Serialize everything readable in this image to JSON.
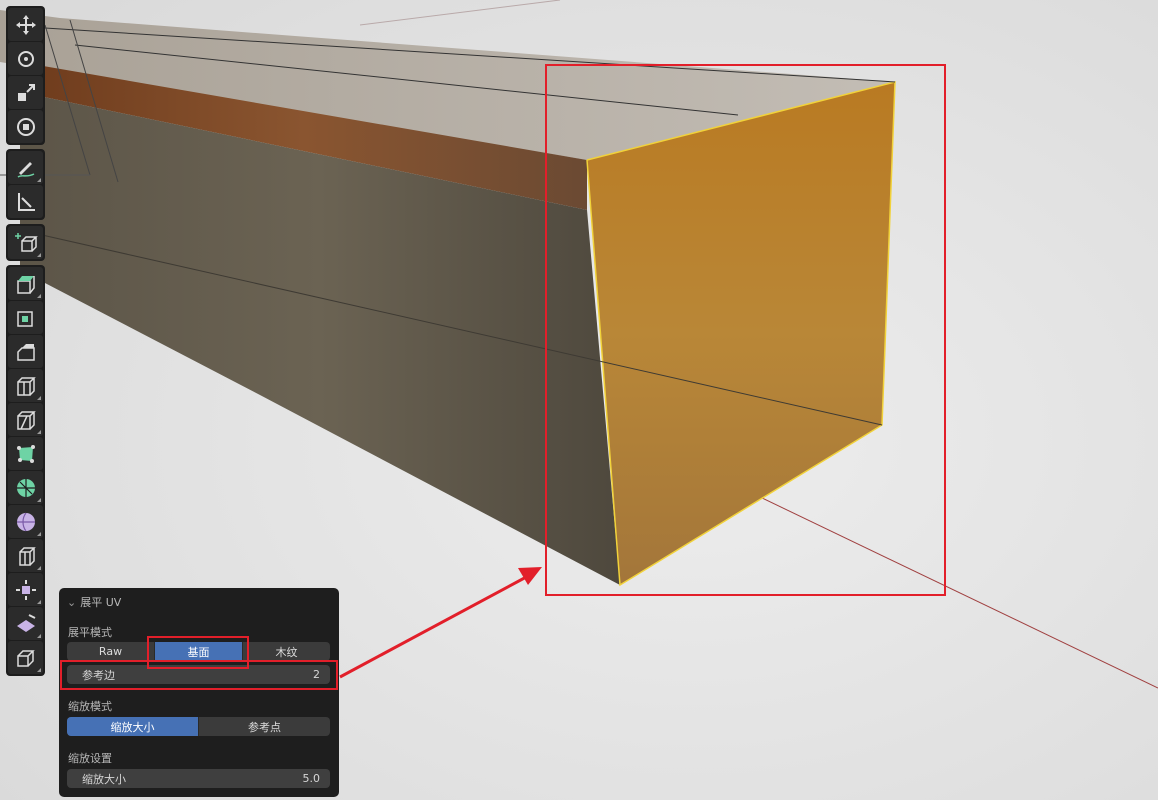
{
  "toolbar": {
    "tools": [
      {
        "name": "move-tool",
        "icon": "move-arrows-icon"
      },
      {
        "name": "rotate-tool",
        "icon": "rotate-icon"
      },
      {
        "name": "scale-tool",
        "icon": "scale-icon"
      },
      {
        "name": "transform-tool",
        "icon": "transform-icon"
      },
      {
        "name": "annotate-tool",
        "icon": "annotate-pencil-icon"
      },
      {
        "name": "measure-tool",
        "icon": "measure-ruler-icon"
      },
      {
        "name": "add-cube-tool",
        "icon": "add-cube-icon"
      },
      {
        "name": "extrude-tool",
        "icon": "extrude-region-icon"
      },
      {
        "name": "inset-tool",
        "icon": "inset-faces-icon"
      },
      {
        "name": "bevel-tool",
        "icon": "bevel-icon"
      },
      {
        "name": "loop-cut-tool",
        "icon": "loop-cut-icon"
      },
      {
        "name": "knife-tool",
        "icon": "knife-icon"
      },
      {
        "name": "poly-build-tool",
        "icon": "poly-build-icon"
      },
      {
        "name": "spin-tool",
        "icon": "spin-icon"
      },
      {
        "name": "smooth-tool",
        "icon": "smooth-sphere-icon"
      },
      {
        "name": "edge-slide-tool",
        "icon": "edge-slide-icon"
      },
      {
        "name": "shrink-fatten-tool",
        "icon": "shrink-fatten-icon"
      },
      {
        "name": "shear-tool",
        "icon": "shear-icon"
      },
      {
        "name": "rip-region-tool",
        "icon": "rip-region-icon"
      }
    ]
  },
  "panel": {
    "title": "展平 UV",
    "unwrap_mode_label": "展平模式",
    "unwrap_modes": [
      "Raw",
      "基面",
      "木纹"
    ],
    "unwrap_mode_selected": "基面",
    "reference_edge_label": "参考边",
    "reference_edge_value": "2",
    "scale_mode_label": "缩放模式",
    "scale_modes": [
      "缩放大小",
      "参考点"
    ],
    "scale_mode_selected": "缩放大小",
    "scale_settings_label": "缩放设置",
    "scale_size_label": "缩放大小",
    "scale_size_value": "5.0"
  },
  "colors": {
    "highlight": "#e21f2a",
    "selected_face": "#c8861d",
    "active_option": "#4671b5"
  }
}
